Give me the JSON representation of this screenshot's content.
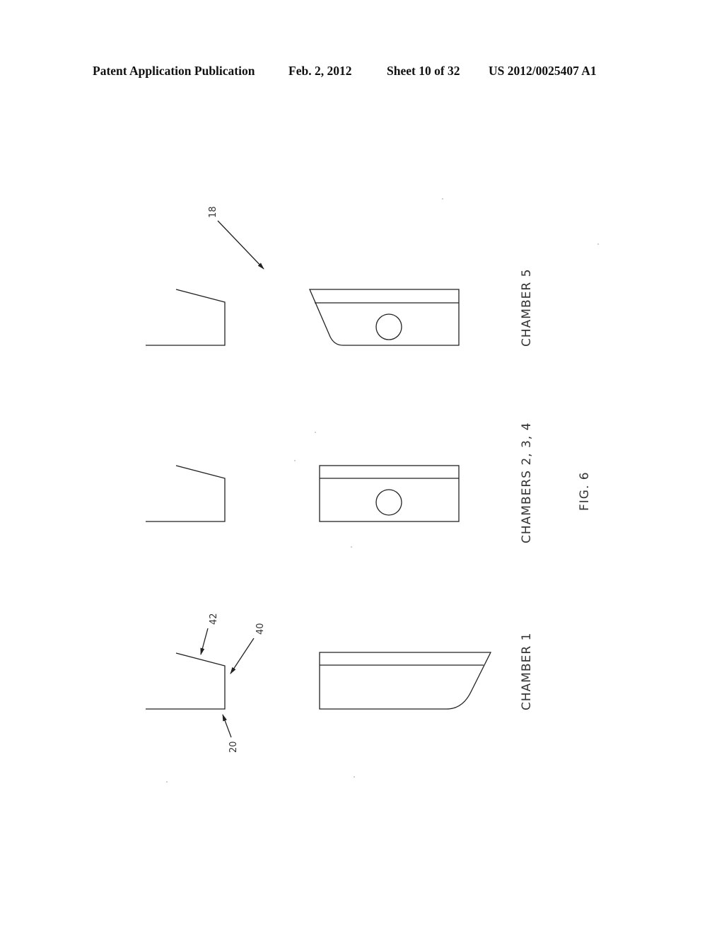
{
  "header": {
    "title": "Patent Application Publication",
    "date": "Feb. 2, 2012",
    "sheet": "Sheet 10 of 32",
    "publication_number": "US 2012/0025407 A1"
  },
  "figure": {
    "label": "FIG. 6",
    "rows": [
      {
        "caption": "CHAMBER 5",
        "has_hole": true,
        "reference_numerals": [
          "18"
        ]
      },
      {
        "caption": "CHAMBERS 2, 3, 4",
        "has_hole": true,
        "reference_numerals": []
      },
      {
        "caption": "CHAMBER 1",
        "has_hole": false,
        "reference_numerals": [
          "42",
          "40",
          "20"
        ]
      }
    ]
  }
}
